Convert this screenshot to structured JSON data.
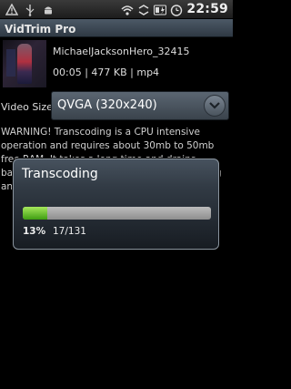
{
  "status_bar": {
    "left_icons": [
      "debug-icon",
      "usb-icon",
      "android-icon"
    ],
    "right_icons": [
      "wifi-icon",
      "sync-icon",
      "battery-status-icon",
      "alarm-icon"
    ],
    "time": "22:59"
  },
  "app": {
    "title": "VidTrim Pro"
  },
  "video": {
    "name": "MichaelJacksonHero_32415",
    "meta": "00:05 | 477 KB | mp4",
    "thumbnail_icon": "video-thumbnail"
  },
  "video_size": {
    "label": "Video Size:",
    "value": "QVGA (320x240)",
    "dropdown_icon": "chevron-down-icon"
  },
  "warning": "WARNING! Transcoding is a CPU intensive operation and requires about 30mb to 50mb free RAM. It takes a long time and drains battery quickly. Run it while phone is charging and do not run other long running programs.",
  "dialog": {
    "title": "Transcoding",
    "progress_percent": 13,
    "percent_label": "13%",
    "count_label": "17/131",
    "colors": {
      "fill_start": "#a6e85c",
      "fill_end": "#3e9d12",
      "track": "#a5a5a5"
    }
  }
}
